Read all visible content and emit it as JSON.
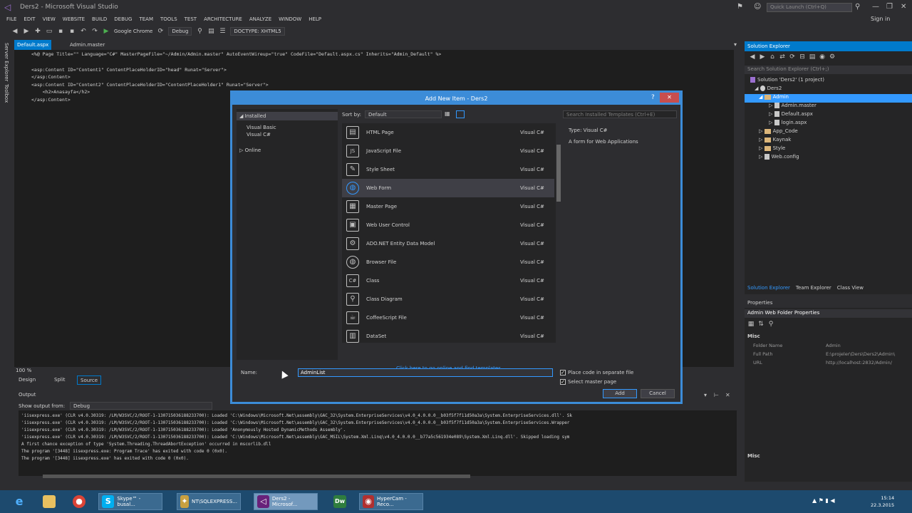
{
  "window": {
    "title": "Ders2 - Microsoft Visual Studio",
    "quick_launch_placeholder": "Quick Launch (Ctrl+Q)",
    "sign_in": "Sign in"
  },
  "menu": [
    "FILE",
    "EDIT",
    "VIEW",
    "WEBSITE",
    "BUILD",
    "DEBUG",
    "TEAM",
    "TOOLS",
    "TEST",
    "ARCHITECTURE",
    "ANALYZE",
    "WINDOW",
    "HELP"
  ],
  "toolbar": {
    "browser": "Google Chrome",
    "config": "Debug",
    "doctype": "DOCTYPE: XHTML5"
  },
  "side_tabs": [
    "Server Explorer",
    "Toolbox"
  ],
  "editor": {
    "tabs": [
      "Default.aspx",
      "Admin.master"
    ],
    "lines": [
      "<%@ Page Title=\"\" Language=\"C#\" MasterPageFile=\"~/Admin/Admin.master\" AutoEventWireup=\"true\" CodeFile=\"Default.aspx.cs\" Inherits=\"Admin_Default\" %>",
      "",
      "<asp:Content ID=\"Content1\" ContentPlaceHolderID=\"head\" Runat=\"Server\">",
      "</asp:Content>",
      "<asp:Content ID=\"Content2\" ContentPlaceHolderID=\"ContentPlaceHolder1\" Runat=\"Server\">",
      "    <h2>Anasayfa</h2>",
      "</asp:Content>"
    ],
    "zoom": "100 %",
    "design_tabs": [
      "Design",
      "Split",
      "Source"
    ]
  },
  "output": {
    "title": "Output",
    "show_from_label": "Show output from:",
    "show_from_value": "Debug",
    "lines": [
      "'iisexpress.exe' (CLR v4.0.30319: /LM/W3SVC/2/ROOT-1-130715036188233700): Loaded 'C:\\Windows\\Microsoft.Net\\assembly\\GAC_32\\System.EnterpriseServices\\v4.0_4.0.0.0__b03f5f7f11d50a3a\\System.EnterpriseServices.dll'. Sk",
      "'iisexpress.exe' (CLR v4.0.30319: /LM/W3SVC/2/ROOT-1-130715036188233700): Loaded 'C:\\Windows\\Microsoft.Net\\assembly\\GAC_32\\System.EnterpriseServices\\v4.0_4.0.0.0__b03f5f7f11d50a3a\\System.EnterpriseServices.Wrapper",
      "'iisexpress.exe' (CLR v4.0.30319: /LM/W3SVC/2/ROOT-1-130715036188233700): Loaded 'Anonymously Hosted DynamicMethods Assembly'.",
      "'iisexpress.exe' (CLR v4.0.30319: /LM/W3SVC/2/ROOT-1-130715036188233700): Loaded 'C:\\Windows\\Microsoft.Net\\assembly\\GAC_MSIL\\System.Xml.Linq\\v4.0_4.0.0.0__b77a5c561934e089\\System.Xml.Linq.dll'. Skipped loading sym",
      "A first chance exception of type 'System.Threading.ThreadAbortException' occurred in mscorlib.dll",
      "The program '[3448] iisexpress.exe: Program Trace' has exited with code 0 (0x0).",
      "The program '[3448] iisexpress.exe' has exited with code 0 (0x0)."
    ]
  },
  "solution_explorer": {
    "title": "Solution Explorer",
    "search_placeholder": "Search Solution Explorer (Ctrl+;)",
    "tree": [
      {
        "label": "Solution 'Ders2' (1 project)",
        "indent": 0,
        "kind": "solution"
      },
      {
        "label": "Ders2",
        "indent": 1,
        "kind": "project"
      },
      {
        "label": "Admin",
        "indent": 2,
        "kind": "folder",
        "selected": true
      },
      {
        "label": "Admin.master",
        "indent": 3,
        "kind": "file"
      },
      {
        "label": "Default.aspx",
        "indent": 3,
        "kind": "file"
      },
      {
        "label": "login.aspx",
        "indent": 3,
        "kind": "file"
      },
      {
        "label": "App_Code",
        "indent": 2,
        "kind": "folder"
      },
      {
        "label": "Kaynak",
        "indent": 2,
        "kind": "folder"
      },
      {
        "label": "Style",
        "indent": 2,
        "kind": "folder"
      },
      {
        "label": "Web.config",
        "indent": 2,
        "kind": "file"
      }
    ],
    "bottom_tabs": [
      "Solution Explorer",
      "Team Explorer",
      "Class View"
    ]
  },
  "properties": {
    "title": "Properties",
    "object": "Admin  Web Folder Properties",
    "category": "Misc",
    "rows": [
      {
        "name": "Folder Name",
        "value": "Admin"
      },
      {
        "name": "Full Path",
        "value": "E:\\projeler\\Ders\\Ders2\\Admin\\"
      },
      {
        "name": "URL",
        "value": "http://localhost:2832/Admin/"
      }
    ],
    "footer": "Misc"
  },
  "dialog": {
    "title": "Add New Item - Ders2",
    "help": "?",
    "close": "✕",
    "tree": {
      "installed": "Installed",
      "children": [
        "Visual Basic",
        "Visual C#"
      ],
      "online": "Online"
    },
    "sort_label": "Sort by:",
    "sort_value": "Default",
    "search_placeholder": "Search Installed Templates (Ctrl+E)",
    "items": [
      {
        "name": "HTML Page",
        "lang": "Visual C#",
        "icon": "html-page-icon",
        "glyph": "▤"
      },
      {
        "name": "JavaScript File",
        "lang": "Visual C#",
        "icon": "javascript-file-icon",
        "glyph": "JS"
      },
      {
        "name": "Style Sheet",
        "lang": "Visual C#",
        "icon": "style-sheet-icon",
        "glyph": "✎"
      },
      {
        "name": "Web Form",
        "lang": "Visual C#",
        "icon": "web-form-icon",
        "glyph": "🌐",
        "selected": true
      },
      {
        "name": "Master Page",
        "lang": "Visual C#",
        "icon": "master-page-icon",
        "glyph": "▦"
      },
      {
        "name": "Web User Control",
        "lang": "Visual C#",
        "icon": "web-user-control-icon",
        "glyph": "▣"
      },
      {
        "name": "ADO.NET Entity Data Model",
        "lang": "Visual C#",
        "icon": "entity-data-model-icon",
        "glyph": "⚙"
      },
      {
        "name": "Browser File",
        "lang": "Visual C#",
        "icon": "browser-file-icon",
        "glyph": "🌐"
      },
      {
        "name": "Class",
        "lang": "Visual C#",
        "icon": "class-icon",
        "glyph": "C#"
      },
      {
        "name": "Class Diagram",
        "lang": "Visual C#",
        "icon": "class-diagram-icon",
        "glyph": "⚲"
      },
      {
        "name": "CoffeeScript File",
        "lang": "Visual C#",
        "icon": "coffeescript-file-icon",
        "glyph": "☕"
      },
      {
        "name": "DataSet",
        "lang": "Visual C#",
        "icon": "dataset-icon",
        "glyph": "▥"
      }
    ],
    "type_label": "Type:  Visual C#",
    "description": "A form for Web Applications",
    "online_link": "Click here to go online and find templates.",
    "name_label": "Name:",
    "name_value": "AdminList",
    "place_code_label": "Place code in separate file",
    "select_master_label": "Select master page",
    "add_button": "Add",
    "cancel_button": "Cancel"
  },
  "taskbar": {
    "apps": [
      {
        "label": "Skype™ - busal...",
        "icon": "skype-icon",
        "glyph": "S",
        "color": "#00aff0"
      },
      {
        "label": "NT\\SQLEXPRESS...",
        "icon": "sql-server-icon",
        "glyph": "✦",
        "color": "#c8a040"
      },
      {
        "label": "Ders2 - Microsof...",
        "icon": "visual-studio-icon",
        "glyph": "◁",
        "color": "#68217a",
        "active": true
      },
      {
        "label": "HyperCam - Reco...",
        "icon": "hypercam-icon",
        "glyph": "◉",
        "color": "#b03030"
      }
    ],
    "time": "15:14",
    "date": "22.3.2015"
  },
  "colors": {
    "accent": "#007acc",
    "dialog_border": "#3c8cd8",
    "editor_bg": "#1e1e1e",
    "chrome_bg": "#2d2d30",
    "taskbar_bg": "#1d4a6e"
  }
}
